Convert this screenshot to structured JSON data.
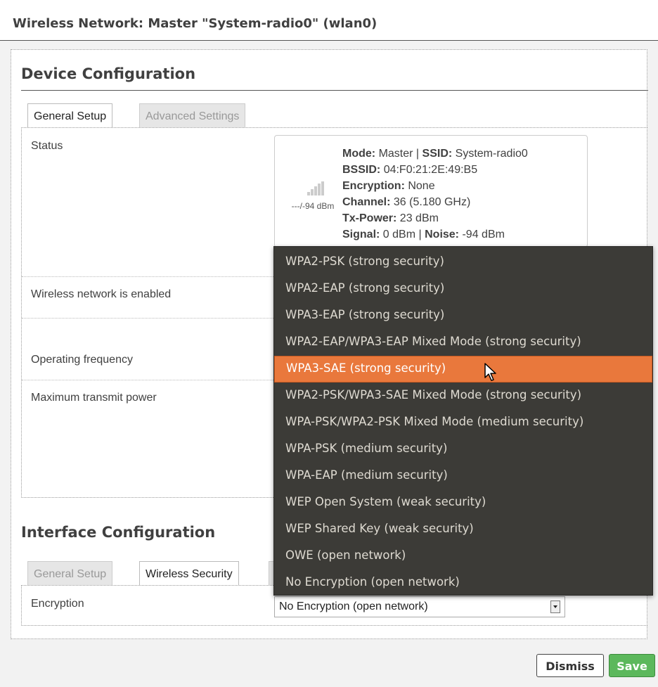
{
  "modal": {
    "title": "Wireless Network: Master \"System-radio0\" (wlan0)"
  },
  "device_config": {
    "heading": "Device Configuration",
    "tabs": [
      {
        "label": "General Setup",
        "active": true
      },
      {
        "label": "Advanced Settings",
        "active": false
      }
    ],
    "rows": {
      "status_label": "Status",
      "enabled_label": "Wireless network is enabled",
      "frequency_label": "Operating frequency",
      "tx_power_label": "Maximum transmit power"
    },
    "status": {
      "signal_text": "---/-94 dBm",
      "mode_key": "Mode:",
      "mode_val": "Master",
      "sep": "|",
      "ssid_key": "SSID:",
      "ssid_val": "System-radio0",
      "bssid_key": "BSSID:",
      "bssid_val": "04:F0:21:2E:49:B5",
      "enc_key": "Encryption:",
      "enc_val": "None",
      "channel_key": "Channel:",
      "channel_val": "36 (5.180 GHz)",
      "txp_key": "Tx-Power:",
      "txp_val": "23 dBm",
      "signal_key": "Signal:",
      "signal_val": "0 dBm",
      "noise_key": "Noise:",
      "noise_val": "-94 dBm"
    }
  },
  "interface_config": {
    "heading": "Interface Configuration",
    "tabs": [
      {
        "label": "General Setup",
        "active": false
      },
      {
        "label": "Wireless Security",
        "active": true
      }
    ],
    "encryption_label": "Encryption",
    "encryption_value": "No Encryption (open network)"
  },
  "dropdown": {
    "highlighted_index": 4,
    "options": [
      "WPA2-PSK (strong security)",
      "WPA2-EAP (strong security)",
      "WPA3-EAP (strong security)",
      "WPA2-EAP/WPA3-EAP Mixed Mode (strong security)",
      "WPA3-SAE (strong security)",
      "WPA2-PSK/WPA3-SAE Mixed Mode (strong security)",
      "WPA-PSK/WPA2-PSK Mixed Mode (medium security)",
      "WPA-PSK (medium security)",
      "WPA-EAP (medium security)",
      "WEP Open System (weak security)",
      "WEP Shared Key (weak security)",
      "OWE (open network)",
      "No Encryption (open network)"
    ]
  },
  "footer": {
    "dismiss_label": "Dismiss",
    "save_label": "Save",
    "save_color": "#5cb85c",
    "highlight_color": "#e9783c",
    "menu_bg_color": "#3c3b37"
  }
}
